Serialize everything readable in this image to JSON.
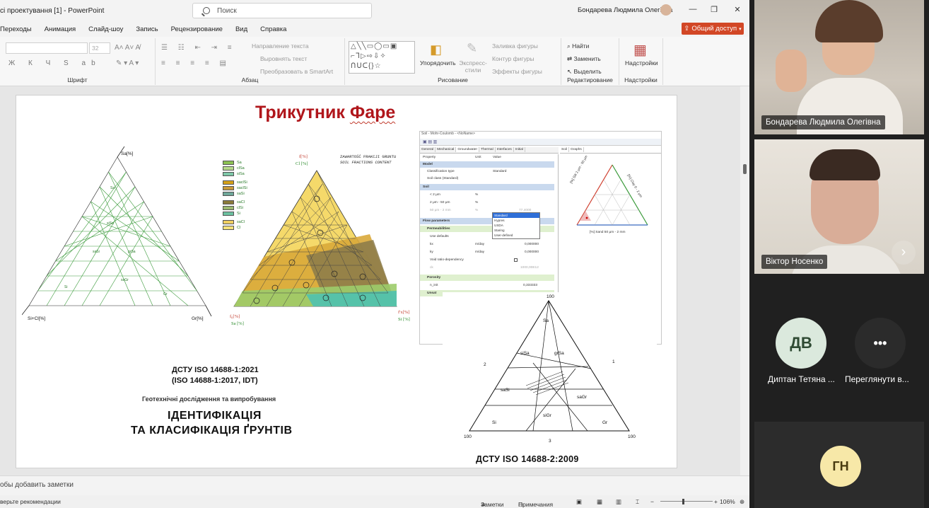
{
  "window": {
    "doc_title": "сі проектування [1]  -  PowerPoint",
    "search_placeholder": "Поиск",
    "user_name": "Бондарева Людмила Олегівна"
  },
  "menu": [
    "Переходы",
    "Анимация",
    "Слайд-шоу",
    "Запись",
    "Рецензирование",
    "Вид",
    "Справка"
  ],
  "share_label": "Общий доступ",
  "ribbon": {
    "font_size": "32",
    "font_glyphs": "Ж К Ч S ab",
    "group_font": "Шрифт",
    "group_paragraph": "Абзац",
    "group_drawing": "Рисование",
    "group_editing": "Редактирование",
    "group_addins": "Надстройки",
    "text_direction": "Направление текста",
    "align_text": "Выровнять текст",
    "smartart": "Преобразовать в SmartArt",
    "arrange": "Упорядочить",
    "quick_styles": "Экспресс-стили",
    "shape_fill": "Заливка фигуры",
    "shape_outline": "Контур фигуры",
    "shape_effects": "Эффекты фигуры",
    "find": "Найти",
    "replace": "Заменить",
    "select": "Выделить",
    "addins": "Надстройки"
  },
  "slide": {
    "title_part1": "Трикутник ",
    "title_part2": "Фаре",
    "dstu_line1": "ДСТУ ISO 14688-1:2021",
    "dstu_line2": "(ISO 14688-1:2017, IDT)",
    "subtitle": "Геотехнічні дослідження та випробування",
    "heading1": "ІДЕНТИФІКАЦІЯ",
    "heading2": "ТА КЛАСИФІКАЦІЯ ҐРУНТІВ",
    "dstu_bottom": "ДСТУ ISO 14688-2:2009",
    "left_triangle": {
      "corner_top": "Sa[%]",
      "corner_left": "Si+Cl[%]",
      "corner_right": "Gr[%]"
    },
    "legend_items": [
      "Sa",
      "clSa",
      "siSa",
      "saclSi",
      "saclSi",
      "saSi",
      "saCl",
      "clSi",
      "Si",
      "saCl",
      "Cl"
    ],
    "middle_triangle": {
      "header1": "ZAWARTOŚĆ FRAKCJI GRUNTU",
      "header2": "SOIL FRACTIONS CONTENT",
      "top_label1": "f[%]",
      "top_label2": "Cl [%]",
      "left_label1": "f₀[%]",
      "left_label2": "Sa [%]",
      "right_label1": "f'x[%]",
      "right_label2": "Si [%]"
    },
    "soil_dialog": {
      "title": "Soil - Mohr-Coulomb - <NoName>",
      "tabs": [
        "General",
        "Mechanical",
        "Groundwater",
        "Thermal",
        "Interfaces",
        "Initial"
      ],
      "right_tabs": [
        "Soil",
        "Graphs"
      ],
      "col_property": "Property",
      "col_unit": "Unit",
      "col_value": "Value",
      "rows": [
        {
          "label": "Model",
          "kind": "hdr"
        },
        {
          "label": "Classification type",
          "unit": "",
          "value": "Standard"
        },
        {
          "label": "Soil class (Standard)",
          "unit": "",
          "value": ""
        },
        {
          "label": "Soil",
          "kind": "hdr"
        },
        {
          "label": "< 2 μm",
          "unit": "%",
          "value": ""
        },
        {
          "label": "2 μm - 50 μm",
          "unit": "%",
          "value": ""
        },
        {
          "label": "50 μm - 2 mm",
          "unit": "%",
          "value": "77,4000"
        },
        {
          "label": "Flow parameters",
          "kind": "hdr"
        },
        {
          "label": "Permeabilities",
          "kind": "sub"
        },
        {
          "label": "Use defaults",
          "unit": "",
          "value": ""
        },
        {
          "label": "kx",
          "unit": "m/day",
          "value": "0,000000"
        },
        {
          "label": "ky",
          "unit": "m/day",
          "value": "0,000000"
        },
        {
          "label": "Void ratio-dependency",
          "unit": "",
          "value": ""
        },
        {
          "label": "ck",
          "unit": "",
          "value": "1000,00E12"
        },
        {
          "label": "Porosity",
          "kind": "sub"
        },
        {
          "label": "n_init",
          "unit": "",
          "value": "0,333333"
        },
        {
          "label": "Unsat",
          "kind": "sub"
        }
      ],
      "dropdown": [
        "Standard",
        "Hypres",
        "USDA",
        "Staring",
        "User-defined"
      ],
      "plot_left": "[%] Silt 2 μm - 50 μm",
      "plot_right": "[%] Clay 0 - 2 μm",
      "plot_bottom": "[%] Sand 50 μm - 2 mm"
    }
  },
  "notes_placeholder": "обы добавить заметки",
  "status": {
    "recommendations": "верьте рекомендации",
    "notes": "Заметки",
    "comments": "Примечания",
    "zoom": "106%"
  },
  "teams": {
    "participant1": "Бондарева Людмила Олегівна",
    "participant2": "Віктор Носенко",
    "participant3_initials": "ДВ",
    "participant3": "Диптан Тетяна ...",
    "more_label": "Переглянути в...",
    "participant4_initials": "ГН",
    "more_dots": "•••"
  },
  "colors": {
    "share": "#d24726",
    "title_red": "#b0161b",
    "avatar_dv": "#dbe9dd",
    "avatar_gn": "#f7e8a8"
  }
}
